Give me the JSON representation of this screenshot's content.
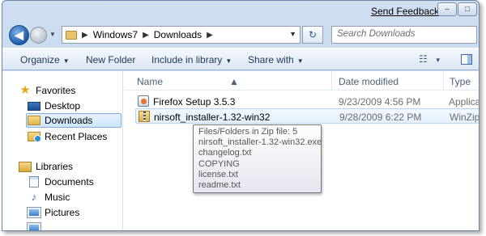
{
  "titlebar": {
    "send_feedback": "Send Feedback",
    "minimize": "–",
    "maximize": "□",
    "close": "✕"
  },
  "address": {
    "breadcrumbs": [
      "Windows7",
      "Downloads"
    ],
    "search_placeholder": "Search Downloads"
  },
  "toolbar": {
    "organize": "Organize",
    "new_folder": "New Folder",
    "include_in_library": "Include in library",
    "share_with": "Share with"
  },
  "navpane": {
    "favorites": "Favorites",
    "desktop": "Desktop",
    "downloads": "Downloads",
    "recent_places": "Recent Places",
    "libraries": "Libraries",
    "documents": "Documents",
    "music": "Music",
    "pictures": "Pictures"
  },
  "columns": {
    "name": "Name",
    "date_modified": "Date modified",
    "type": "Type"
  },
  "files": [
    {
      "name": "Firefox Setup 3.5.3",
      "date": "9/23/2009 4:56 PM",
      "type": "Application"
    },
    {
      "name": "nirsoft_installer-1.32-win32",
      "date": "9/28/2009 6:22 PM",
      "type": "WinZip File"
    }
  ],
  "tooltip": {
    "lines": [
      "Files/Folders in Zip file: 5",
      "nirsoft_installer-1.32-win32.exe",
      "changelog.txt",
      "COPYING",
      "license.txt",
      "readme.txt"
    ]
  },
  "colors": {
    "window_frame": "#bcd1ea",
    "selection": "#cde6fb",
    "accent": "#1f5aa8"
  }
}
